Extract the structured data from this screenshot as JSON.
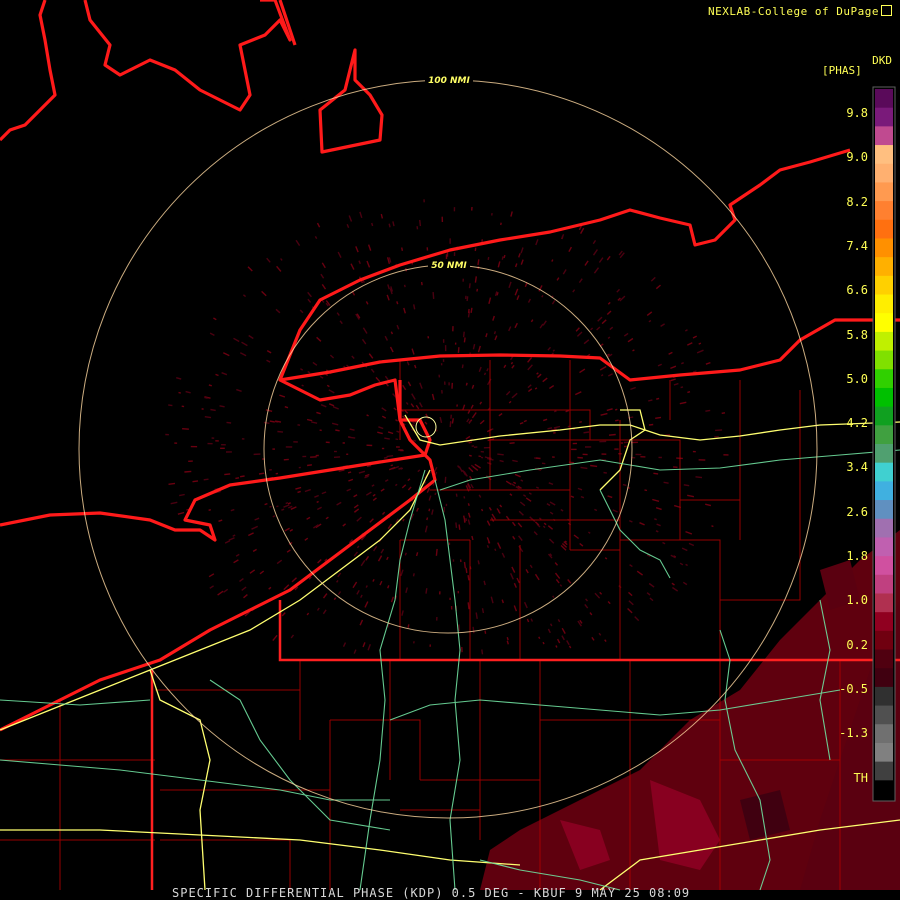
{
  "header": {
    "credit": "NEXLAB-College of DuPage"
  },
  "legend": {
    "product_code": "DKD",
    "units": "[PHAS]",
    "ticks": [
      "9.8",
      "9.0",
      "8.2",
      "7.4",
      "6.6",
      "5.8",
      "5.0",
      "4.2",
      "3.4",
      "2.6",
      "1.8",
      "1.0",
      "0.2",
      "-0.5",
      "-1.3",
      "TH"
    ],
    "colors": [
      "#5a0a5a",
      "#7a1a7a",
      "#c04a90",
      "#ffbf80",
      "#ffb070",
      "#ff9a50",
      "#ff8030",
      "#ff7010",
      "#ff9000",
      "#ffb000",
      "#ffd000",
      "#ffee00",
      "#ffff00",
      "#c0f000",
      "#80e000",
      "#30d000",
      "#00c000",
      "#10a020",
      "#40a040",
      "#50a070",
      "#40d0d0",
      "#40b0e0",
      "#6090c0",
      "#a070b0",
      "#c060b0",
      "#d050a0",
      "#c04080",
      "#b03050",
      "#900020",
      "#700010",
      "#500010",
      "#400010",
      "#303030",
      "#505050",
      "#707070",
      "#808080",
      "#404040",
      "#000000"
    ]
  },
  "rings": [
    {
      "label": "100 NMI"
    },
    {
      "label": "50 NMI"
    }
  ],
  "footer": {
    "caption": "SPECIFIC DIFFERENTIAL PHASE (KDP) 0.5 DEG - KBUF 9 MAY 25 08:09"
  }
}
